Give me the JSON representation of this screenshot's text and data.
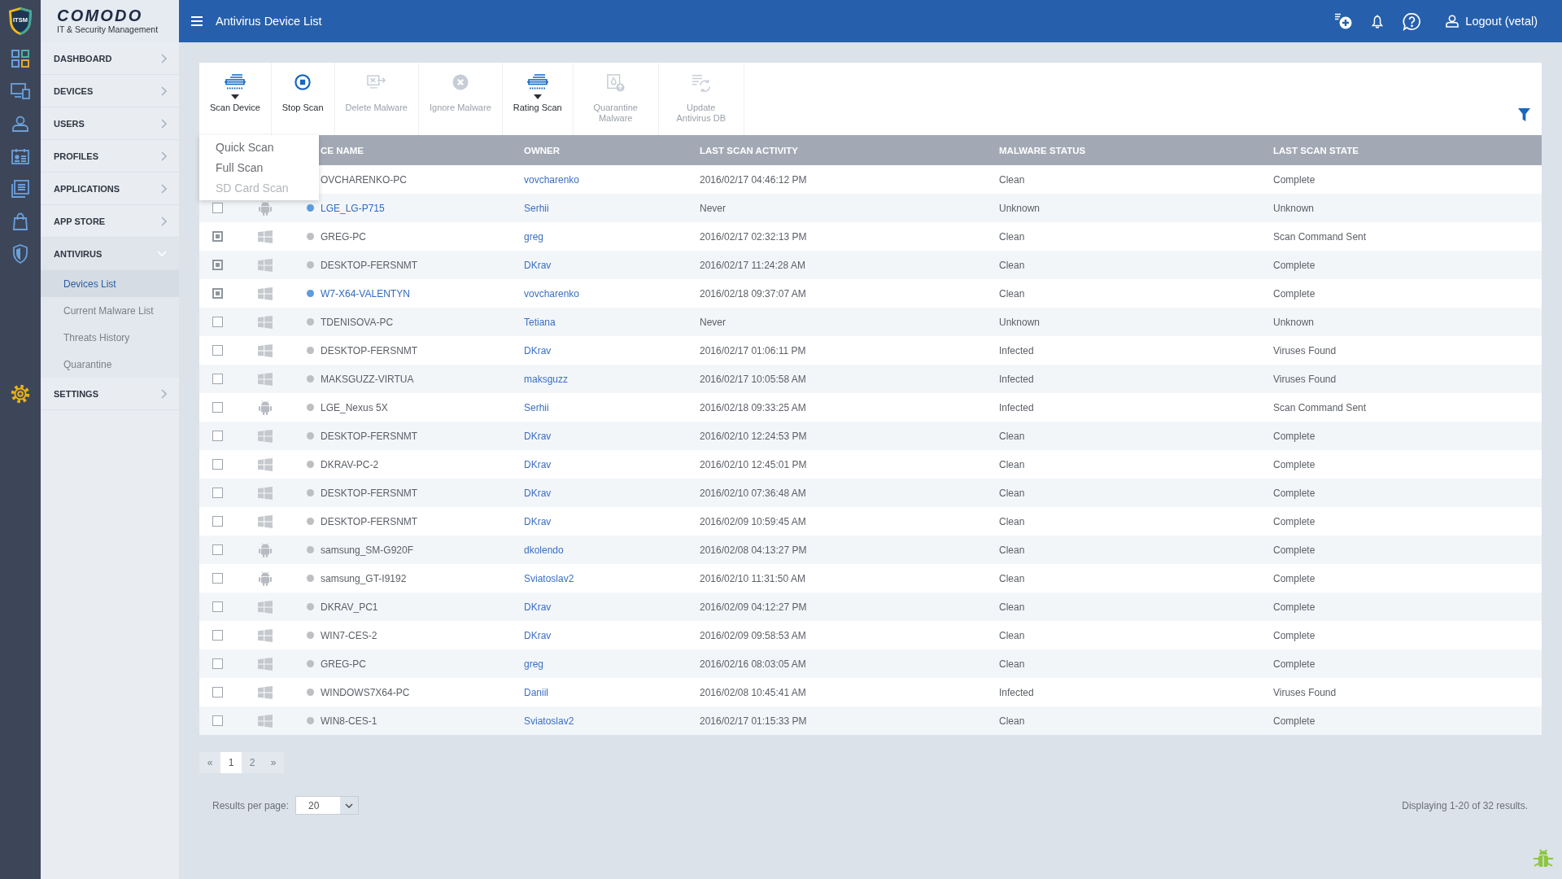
{
  "logo": {
    "badge": "ITSM",
    "name": "COMODO",
    "tagline": "IT & Security Management"
  },
  "sidebar": {
    "items": [
      {
        "label": "DASHBOARD",
        "expanded": false
      },
      {
        "label": "DEVICES",
        "expanded": false
      },
      {
        "label": "USERS",
        "expanded": false
      },
      {
        "label": "PROFILES",
        "expanded": false
      },
      {
        "label": "APPLICATIONS",
        "expanded": false
      },
      {
        "label": "APP STORE",
        "expanded": false
      },
      {
        "label": "ANTIVIRUS",
        "expanded": true,
        "children": [
          {
            "label": "Devices List",
            "selected": true
          },
          {
            "label": "Current Malware List",
            "selected": false
          },
          {
            "label": "Threats History",
            "selected": false
          },
          {
            "label": "Quarantine",
            "selected": false
          }
        ]
      },
      {
        "label": "SETTINGS",
        "expanded": false
      }
    ]
  },
  "header": {
    "title": "Antivirus Device List",
    "logout": "Logout (vetal)"
  },
  "toolbar": {
    "buttons": [
      {
        "label": "Scan Device",
        "disabled": false,
        "caret": true
      },
      {
        "label": "Stop Scan",
        "disabled": false,
        "caret": false
      },
      {
        "label": "Delete Malware",
        "disabled": true,
        "caret": false
      },
      {
        "label": "Ignore Malware",
        "disabled": true,
        "caret": false
      },
      {
        "label": "Rating Scan",
        "disabled": false,
        "caret": true
      },
      {
        "label": "Quarantine Malware",
        "disabled": true,
        "caret": false
      },
      {
        "label": "Update Antivirus DB",
        "disabled": true,
        "caret": false
      }
    ],
    "menu": {
      "items": [
        {
          "label": "Quick Scan",
          "disabled": false
        },
        {
          "label": "Full Scan",
          "disabled": false
        },
        {
          "label": "SD Card Scan",
          "disabled": true
        }
      ]
    }
  },
  "table": {
    "columns": [
      "CE NAME",
      "OWNER",
      "LAST SCAN ACTIVITY",
      "MALWARE STATUS",
      "LAST SCAN STATE"
    ],
    "rows": [
      {
        "name": "OVCHARENKO-PC",
        "owner": "vovcharenko",
        "last_scan_activity": "2016/02/17 04:46:12 PM",
        "malware_status": "Clean",
        "last_scan_state": "Complete"
      },
      {
        "checked": false,
        "kind": "android",
        "online": true,
        "name": "LGE_LG-P715",
        "owner": "Serhii",
        "last_scan_activity": "Never",
        "malware_status": "Unknown",
        "last_scan_state": "Unknown"
      },
      {
        "checked": true,
        "kind": "windows",
        "online": false,
        "name": "GREG-PC",
        "owner": "greg",
        "last_scan_activity": "2016/02/17 02:32:13 PM",
        "malware_status": "Clean",
        "last_scan_state": "Scan Command Sent"
      },
      {
        "checked": true,
        "kind": "windows",
        "online": false,
        "name": "DESKTOP-FERSNMT",
        "owner": "DKrav",
        "last_scan_activity": "2016/02/17 11:24:28 AM",
        "malware_status": "Clean",
        "last_scan_state": "Complete"
      },
      {
        "checked": true,
        "kind": "windows",
        "online": true,
        "name": "W7-X64-VALENTYN",
        "owner": "vovcharenko",
        "last_scan_activity": "2016/02/18 09:37:07 AM",
        "malware_status": "Clean",
        "last_scan_state": "Complete"
      },
      {
        "checked": false,
        "kind": "windows",
        "online": false,
        "name": "TDENISOVA-PC",
        "owner": "Tetiana",
        "last_scan_activity": "Never",
        "malware_status": "Unknown",
        "last_scan_state": "Unknown"
      },
      {
        "checked": false,
        "kind": "windows",
        "online": false,
        "name": "DESKTOP-FERSNMT",
        "owner": "DKrav",
        "last_scan_activity": "2016/02/17 01:06:11 PM",
        "malware_status": "Infected",
        "last_scan_state": "Viruses Found"
      },
      {
        "checked": false,
        "kind": "windows",
        "online": false,
        "name": "MAKSGUZZ-VIRTUA",
        "owner": "maksguzz",
        "last_scan_activity": "2016/02/17 10:05:58 AM",
        "malware_status": "Infected",
        "last_scan_state": "Viruses Found"
      },
      {
        "checked": false,
        "kind": "android",
        "online": false,
        "name": "LGE_Nexus 5X",
        "owner": "Serhii",
        "last_scan_activity": "2016/02/18 09:33:25 AM",
        "malware_status": "Infected",
        "last_scan_state": "Scan Command Sent"
      },
      {
        "checked": false,
        "kind": "windows",
        "online": false,
        "name": "DESKTOP-FERSNMT",
        "owner": "DKrav",
        "last_scan_activity": "2016/02/10 12:24:53 PM",
        "malware_status": "Clean",
        "last_scan_state": "Complete"
      },
      {
        "checked": false,
        "kind": "windows",
        "online": false,
        "name": "DKRAV-PC-2",
        "owner": "DKrav",
        "last_scan_activity": "2016/02/10 12:45:01 PM",
        "malware_status": "Clean",
        "last_scan_state": "Complete"
      },
      {
        "checked": false,
        "kind": "windows",
        "online": false,
        "name": "DESKTOP-FERSNMT",
        "owner": "DKrav",
        "last_scan_activity": "2016/02/10 07:36:48 AM",
        "malware_status": "Clean",
        "last_scan_state": "Complete"
      },
      {
        "checked": false,
        "kind": "windows",
        "online": false,
        "name": "DESKTOP-FERSNMT",
        "owner": "DKrav",
        "last_scan_activity": "2016/02/09 10:59:45 AM",
        "malware_status": "Clean",
        "last_scan_state": "Complete"
      },
      {
        "checked": false,
        "kind": "android",
        "online": false,
        "name": "samsung_SM-G920F",
        "owner": "dkolendo",
        "last_scan_activity": "2016/02/08 04:13:27 PM",
        "malware_status": "Clean",
        "last_scan_state": "Complete"
      },
      {
        "checked": false,
        "kind": "android",
        "online": false,
        "name": "samsung_GT-I9192",
        "owner": "Sviatoslav2",
        "last_scan_activity": "2016/02/10 11:31:50 AM",
        "malware_status": "Clean",
        "last_scan_state": "Complete"
      },
      {
        "checked": false,
        "kind": "windows",
        "online": false,
        "name": "DKRAV_PC1",
        "owner": "DKrav",
        "last_scan_activity": "2016/02/09 04:12:27 PM",
        "malware_status": "Clean",
        "last_scan_state": "Complete"
      },
      {
        "checked": false,
        "kind": "windows",
        "online": false,
        "name": "WIN7-CES-2",
        "owner": "DKrav",
        "last_scan_activity": "2016/02/09 09:58:53 AM",
        "malware_status": "Clean",
        "last_scan_state": "Complete"
      },
      {
        "checked": false,
        "kind": "windows",
        "online": false,
        "name": "GREG-PC",
        "owner": "greg",
        "last_scan_activity": "2016/02/16 08:03:05 AM",
        "malware_status": "Clean",
        "last_scan_state": "Complete"
      },
      {
        "checked": false,
        "kind": "windows",
        "online": false,
        "name": "WINDOWS7X64-PC",
        "owner": "Daniil",
        "last_scan_activity": "2016/02/08 10:45:41 AM",
        "malware_status": "Infected",
        "last_scan_state": "Viruses Found"
      },
      {
        "checked": false,
        "kind": "windows",
        "online": false,
        "name": "WIN8-CES-1",
        "owner": "Sviatoslav2",
        "last_scan_activity": "2016/02/17 01:15:33 PM",
        "malware_status": "Clean",
        "last_scan_state": "Complete"
      }
    ]
  },
  "pagination": {
    "pages": [
      {
        "label": "«",
        "selected": false
      },
      {
        "label": "1",
        "selected": true
      },
      {
        "label": "2",
        "selected": false
      },
      {
        "label": "»",
        "selected": false
      }
    ]
  },
  "page_size": {
    "label": "Results per page:",
    "value": "20"
  },
  "summary": "Displaying 1-20 of 32 results."
}
